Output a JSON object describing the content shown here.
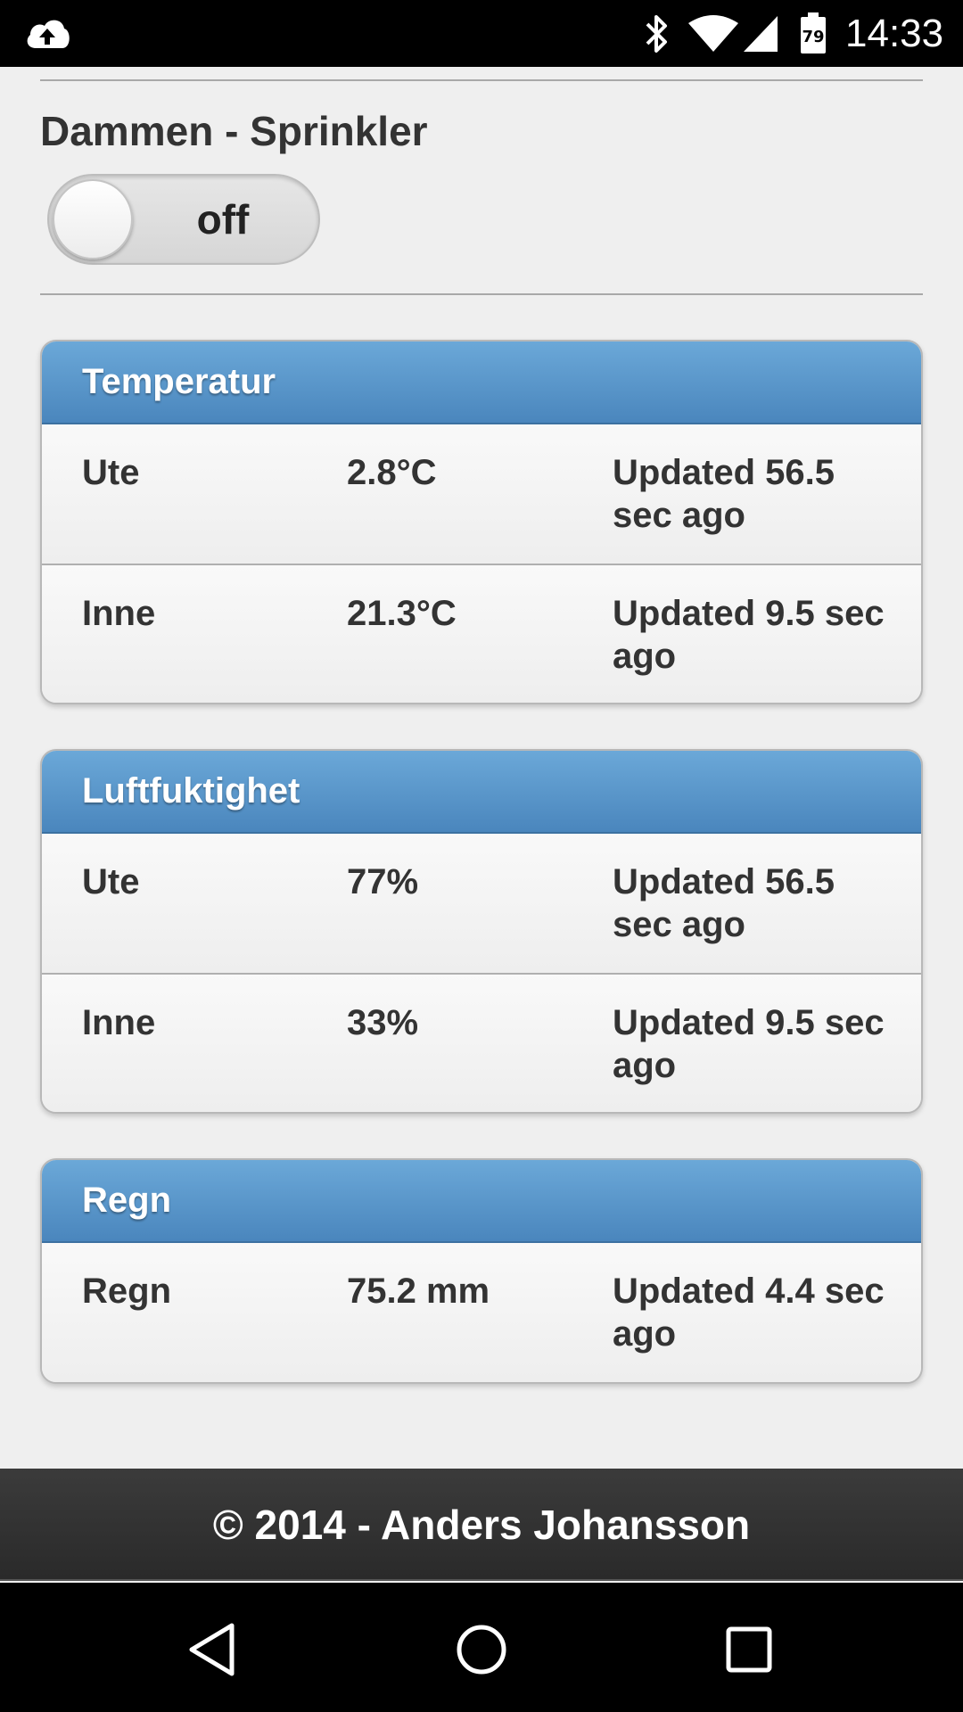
{
  "status_bar": {
    "time": "14:33",
    "battery_level": "79",
    "icons": [
      "cloud-upload-icon",
      "bluetooth-icon",
      "wifi-icon",
      "cell-signal-icon",
      "battery-icon"
    ]
  },
  "switch": {
    "title": "Dammen - Sprinkler",
    "state_label": "off"
  },
  "panels": [
    {
      "title": "Temperatur",
      "rows": [
        {
          "name": "Ute",
          "value": "2.8°C",
          "updated": "Updated 56.5 sec ago"
        },
        {
          "name": "Inne",
          "value": "21.3°C",
          "updated": "Updated 9.5 sec ago"
        }
      ]
    },
    {
      "title": "Luftfuktighet",
      "rows": [
        {
          "name": "Ute",
          "value": "77%",
          "updated": "Updated 56.5 sec ago"
        },
        {
          "name": "Inne",
          "value": "33%",
          "updated": "Updated 9.5 sec ago"
        }
      ]
    },
    {
      "title": "Regn",
      "rows": [
        {
          "name": "Regn",
          "value": "75.2 mm",
          "updated": "Updated 4.4 sec ago"
        }
      ]
    }
  ],
  "footer": {
    "text": "© 2014 - Anders Johansson"
  },
  "nav_bar": {
    "icons": [
      "back-icon",
      "home-icon",
      "recent-apps-icon"
    ]
  },
  "colors": {
    "panel_header_top": "#6ba8d8",
    "panel_header_bottom": "#4a86bd",
    "background": "#efefef",
    "footer": "#333333"
  }
}
